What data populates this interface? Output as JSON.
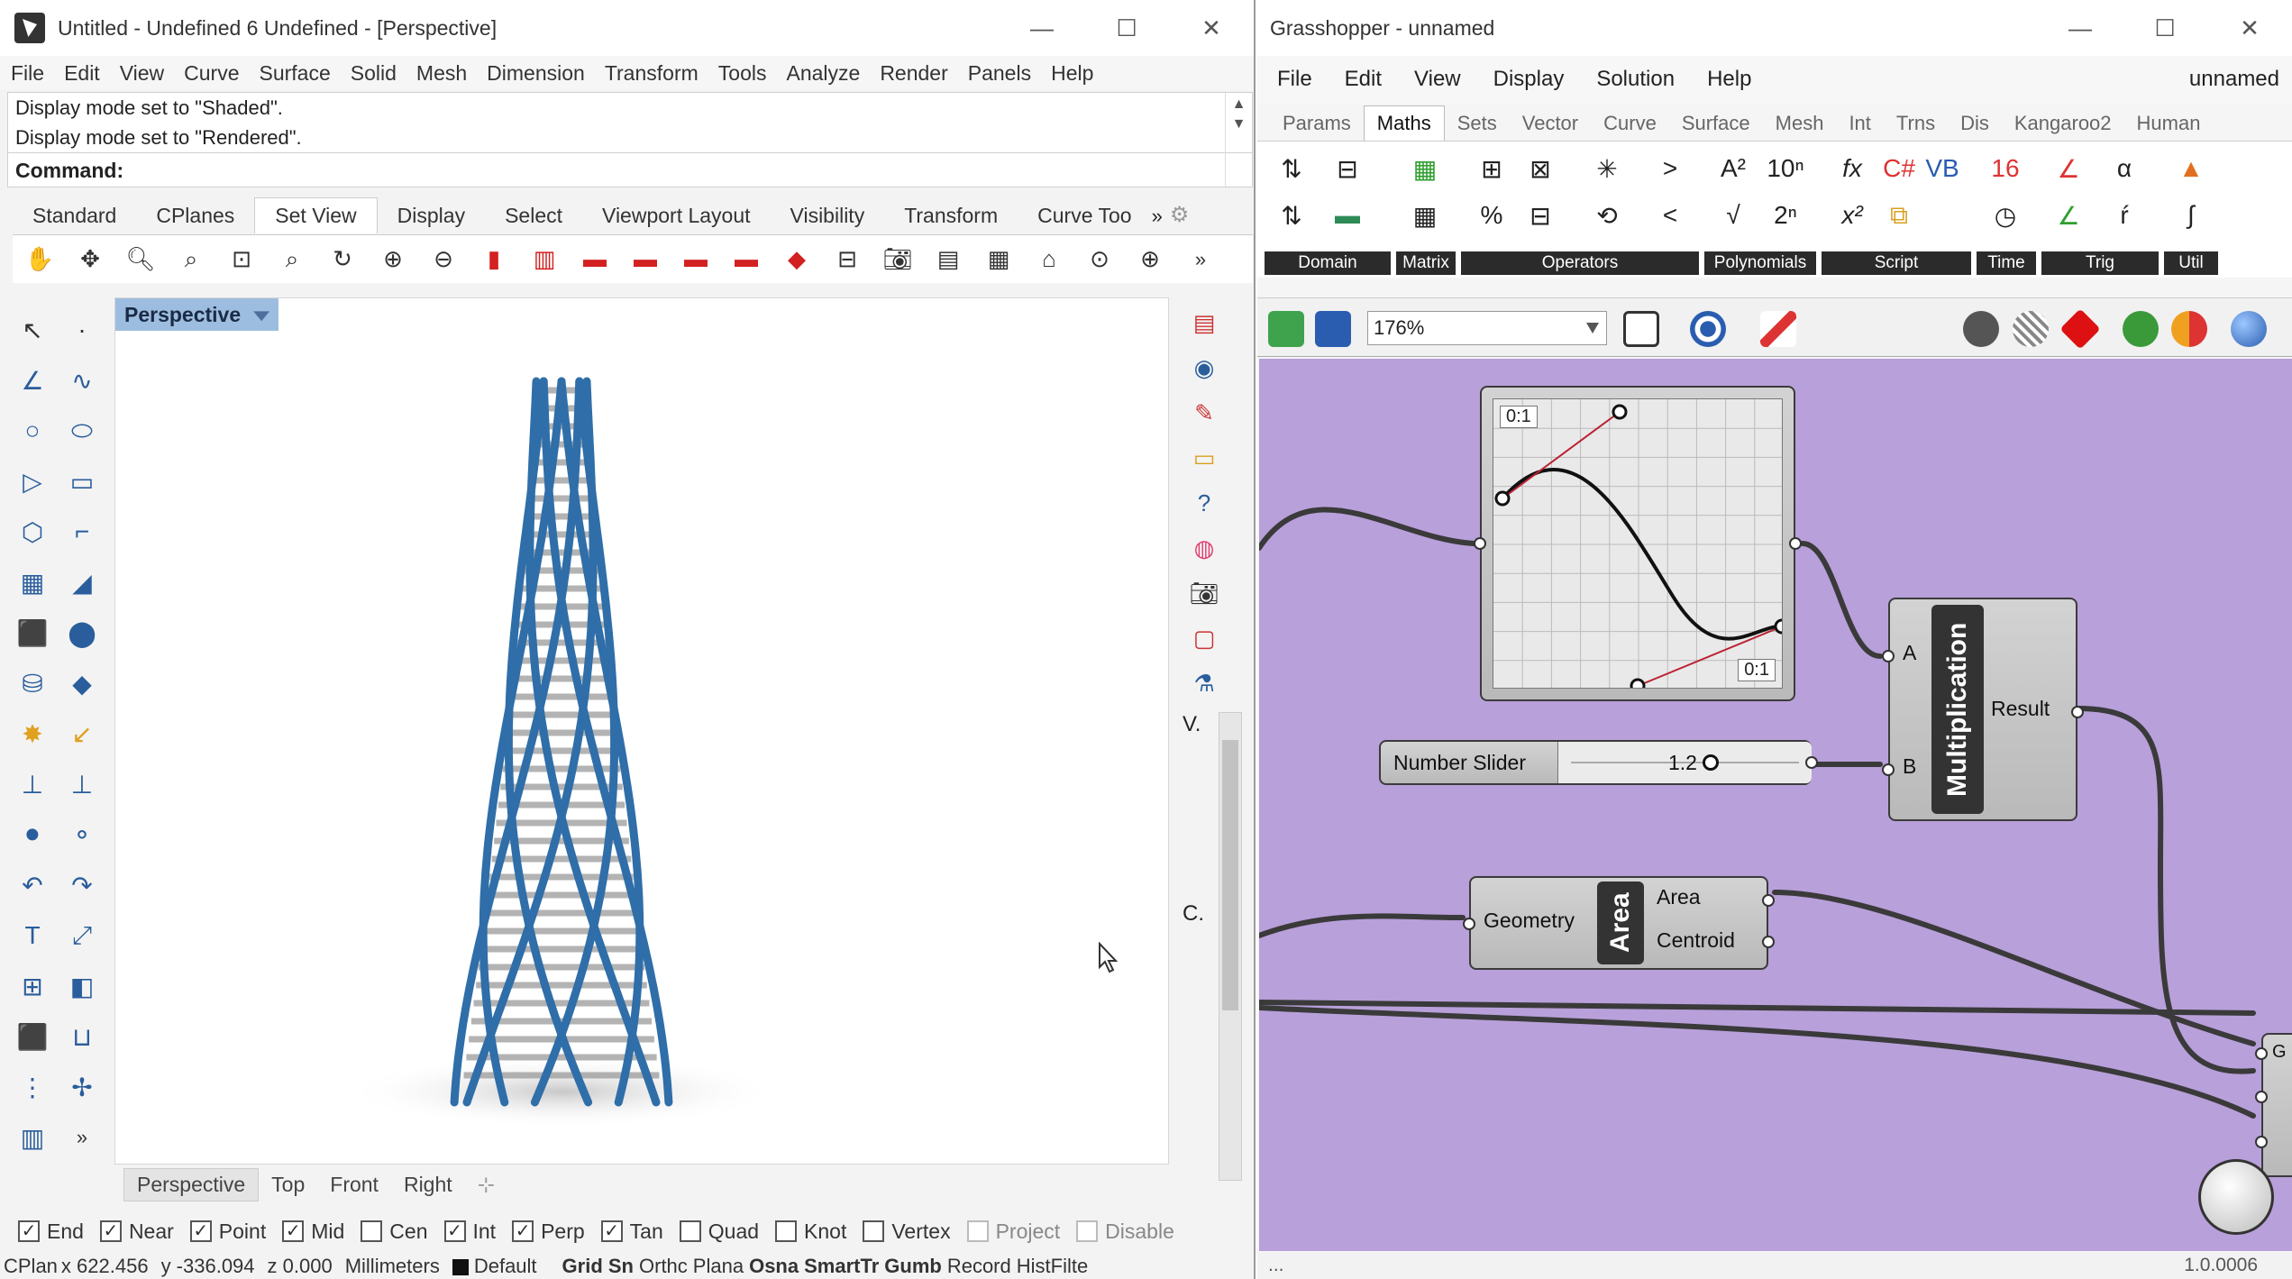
{
  "rhino": {
    "title": "Untitled - Undefined 6 Undefined - [Perspective]",
    "menu": [
      "File",
      "Edit",
      "View",
      "Curve",
      "Surface",
      "Solid",
      "Mesh",
      "Dimension",
      "Transform",
      "Tools",
      "Analyze",
      "Render",
      "Panels",
      "Help"
    ],
    "command_history": [
      "Display mode set to \"Shaded\".",
      "Display mode set to \"Rendered\"."
    ],
    "command_prompt": "Command:",
    "toolbar_tabs": [
      "Standard",
      "CPlanes",
      "Set View",
      "Display",
      "Select",
      "Viewport Layout",
      "Visibility",
      "Transform",
      "Curve Too"
    ],
    "active_toolbar_tab": "Set View",
    "viewport_label": "Perspective",
    "viewport_tabs": [
      "Perspective",
      "Top",
      "Front",
      "Right"
    ],
    "osnaps": [
      {
        "label": "End",
        "checked": true
      },
      {
        "label": "Near",
        "checked": true
      },
      {
        "label": "Point",
        "checked": true
      },
      {
        "label": "Mid",
        "checked": true
      },
      {
        "label": "Cen",
        "checked": false
      },
      {
        "label": "Int",
        "checked": true
      },
      {
        "label": "Perp",
        "checked": true
      },
      {
        "label": "Tan",
        "checked": true
      },
      {
        "label": "Quad",
        "checked": false
      },
      {
        "label": "Knot",
        "checked": false
      },
      {
        "label": "Vertex",
        "checked": false
      },
      {
        "label": "Project",
        "checked": false
      },
      {
        "label": "Disable",
        "checked": false
      }
    ],
    "status": {
      "cplane": "CPlan",
      "x": "x 622.456",
      "y": "y -336.094",
      "z": "z 0.000",
      "units": "Millimeters",
      "layer": "Default",
      "toggles": [
        "Grid Sn",
        "Orthc",
        "Plana",
        "Osna",
        "SmartTr",
        "Gumb",
        "Record",
        "HistFilte"
      ]
    },
    "side_labels": [
      "V.",
      "C."
    ],
    "colors": {
      "tower_blue": "#2f6ea8",
      "viewport_label_bg": "#9dbde0"
    }
  },
  "grasshopper": {
    "title": "Grasshopper - unnamed",
    "doc_name": "unnamed",
    "menu": [
      "File",
      "Edit",
      "View",
      "Display",
      "Solution",
      "Help"
    ],
    "tabs": [
      "Params",
      "Maths",
      "Sets",
      "Vector",
      "Curve",
      "Surface",
      "Mesh",
      "Int",
      "Trns",
      "Dis",
      "Kangaroo2",
      "Human"
    ],
    "active_tab": "Maths",
    "ribbon_groups": [
      "Domain",
      "Matrix",
      "Operators",
      "Polynomials",
      "Script",
      "Time",
      "Trig",
      "Util"
    ],
    "zoom": "176%",
    "graph_mapper": {
      "top_left_label": "0:1",
      "bottom_right_label": "0:1"
    },
    "number_slider": {
      "label": "Number Slider",
      "value": "1.2"
    },
    "multiplication": {
      "name": "Multiplication",
      "inputs": [
        "A",
        "B"
      ],
      "output": "Result"
    },
    "area": {
      "name": "Area",
      "input": "Geometry",
      "outputs": [
        "Area",
        "Centroid"
      ]
    },
    "partial_component_label": "G",
    "status_left": "...",
    "version": "1.0.0006",
    "colors": {
      "canvas": "#b8a0da",
      "component": "#c4c4c4"
    }
  }
}
